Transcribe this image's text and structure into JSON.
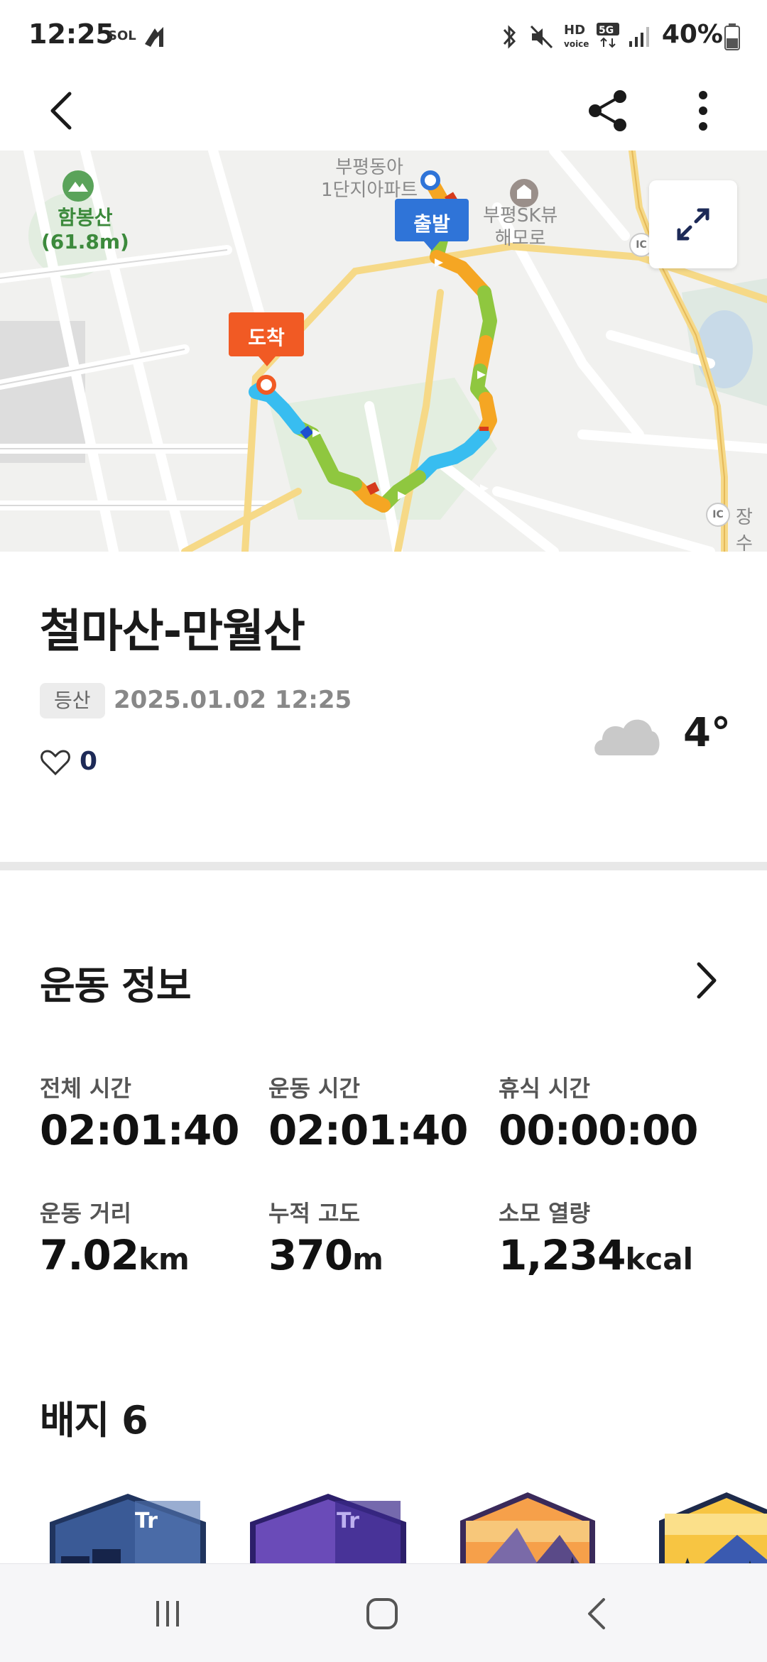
{
  "status_bar": {
    "time": "12:25",
    "battery": "40%"
  },
  "map": {
    "labels": {
      "start": "출발",
      "finish": "도착",
      "poi1_line1": "부평동아",
      "poi1_line2": "1단지아파트",
      "poi2_line1": "부평SK뷰",
      "poi2_line2": "해모로",
      "mountain_name": "함봉산",
      "mountain_height": "(61.8m)",
      "ic1": "IC",
      "ic2": "IC",
      "district": "장수"
    },
    "colors": {
      "start": "#2f74d8",
      "finish": "#f15a24"
    }
  },
  "activity": {
    "title": "철마산-만월산",
    "tag": "등산",
    "datetime": "2025.01.02 12:25",
    "likes": "0",
    "weather_icon": "cloud-icon",
    "temperature": "4°"
  },
  "exercise_info": {
    "heading": "운동 정보",
    "stats": [
      {
        "label": "전체 시간",
        "value": "02:01:40",
        "unit": ""
      },
      {
        "label": "운동 시간",
        "value": "02:01:40",
        "unit": ""
      },
      {
        "label": "휴식 시간",
        "value": "00:00:00",
        "unit": ""
      },
      {
        "label": "운동 거리",
        "value": "7.02",
        "unit": "km"
      },
      {
        "label": "누적 고도",
        "value": "370",
        "unit": "m"
      },
      {
        "label": "소모 열량",
        "value": "1,234",
        "unit": "kcal"
      }
    ]
  },
  "badges": {
    "heading": "배지 6"
  }
}
